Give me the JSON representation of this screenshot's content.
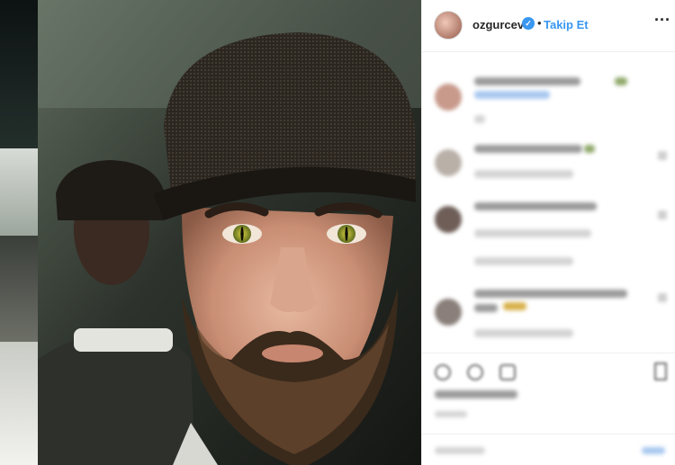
{
  "post": {
    "author": {
      "username": "ozgurcev",
      "verified": true,
      "separator": "•",
      "follow_label": "Takip Et"
    },
    "more_options_icon": "more-horizontal-icon",
    "more_label": "···"
  },
  "photo": {
    "subject": "portrait-with-yellow-eyes"
  },
  "comments": [
    {
      "avatar": "comment-avatar-1"
    },
    {
      "avatar": "comment-avatar-2"
    },
    {
      "avatar": "comment-avatar-3"
    },
    {
      "avatar": "comment-avatar-4"
    }
  ],
  "actions": {
    "icons": [
      "heart-icon",
      "comment-icon",
      "share-icon",
      "bookmark-icon"
    ]
  },
  "colors": {
    "accent": "#3897f0",
    "text": "#262626",
    "border": "#efefef",
    "panel_bg": "#ffffff"
  }
}
